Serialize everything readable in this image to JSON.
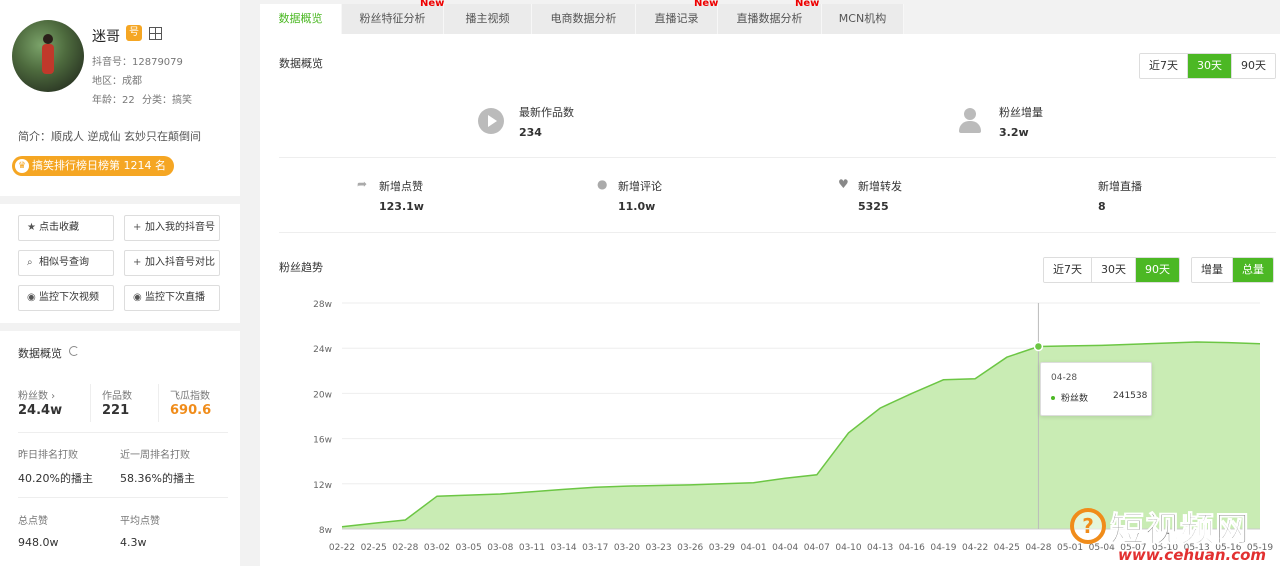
{
  "profile": {
    "name": "迷哥",
    "douyin_id": "抖音号：12879079",
    "region": "地区：成都",
    "age": "年龄：22",
    "category": "分类：搞笑",
    "bio": "简介：顺成人 逆成仙 玄妙只在颠倒间",
    "rank": "搞笑排行榜日榜第 1214 名"
  },
  "actions": [
    {
      "icon": "star-icon",
      "label": "点击收藏"
    },
    {
      "icon": "plus-icon",
      "label": "加入我的抖音号"
    },
    {
      "icon": "search-icon",
      "label": "相似号查询"
    },
    {
      "icon": "plus-icon",
      "label": "加入抖音号对比"
    },
    {
      "icon": "eye-icon",
      "label": "监控下次视频"
    },
    {
      "icon": "eye-icon",
      "label": "监控下次直播"
    }
  ],
  "overview": {
    "title": "数据概览",
    "fans_label": "粉丝数 ›",
    "fans_value": "24.4w",
    "works_label": "作品数",
    "works_value": "221",
    "index_label": "飞瓜指数",
    "index_value": "690.6",
    "yesterday_label": "昨日排名打败",
    "yesterday_value": "40.20%的播主",
    "week_label": "近一周排名打败",
    "week_value": "58.36%的播主",
    "likes_label": "总点赞",
    "likes_value": "948.0w",
    "avg_label": "平均点赞",
    "avg_value": "4.3w"
  },
  "tabs": [
    {
      "label": "数据概览",
      "active": true,
      "new": false
    },
    {
      "label": "粉丝特征分析",
      "active": false,
      "new": true
    },
    {
      "label": "播主视频",
      "active": false,
      "new": false
    },
    {
      "label": "电商数据分析",
      "active": false,
      "new": false
    },
    {
      "label": "直播记录",
      "active": false,
      "new": true
    },
    {
      "label": "直播数据分析",
      "active": false,
      "new": true
    },
    {
      "label": "MCN机构",
      "active": false,
      "new": false
    }
  ],
  "new_label": "New",
  "main": {
    "section_title": "数据概览",
    "range_buttons": [
      "近7天",
      "30天",
      "90天"
    ],
    "range_active": "30天",
    "latest_works_label": "最新作品数",
    "latest_works_value": "234",
    "fans_inc_label": "粉丝增量",
    "fans_inc_value": "3.2w",
    "likes_inc_label": "新增点赞",
    "likes_inc_value": "123.1w",
    "comments_inc_label": "新增评论",
    "comments_inc_value": "11.0w",
    "shares_inc_label": "新增转发",
    "shares_inc_value": "5325",
    "live_inc_label": "新增直播",
    "live_inc_value": "8"
  },
  "trend": {
    "title": "粉丝趋势",
    "range_buttons": [
      "近7天",
      "30天",
      "90天"
    ],
    "range_active": "90天",
    "mode_buttons": [
      "增量",
      "总量"
    ],
    "mode_active": "总量",
    "tooltip_date": "04-28",
    "tooltip_series": "粉丝数",
    "tooltip_value": "241538"
  },
  "watermark": {
    "text": "短视频网",
    "url": "www.cehuan.com",
    "mark": "?"
  },
  "colors": {
    "accent": "#4cb824",
    "orange": "#f08c1a",
    "area": "#c9ecb4",
    "line": "#6cc644"
  },
  "chart_data": {
    "type": "area",
    "ylabels": [
      "8w",
      "12w",
      "16w",
      "20w",
      "24w",
      "28w"
    ],
    "ylim": [
      80000,
      280000
    ],
    "x": [
      "02-22",
      "02-25",
      "02-28",
      "03-02",
      "03-05",
      "03-08",
      "03-11",
      "03-14",
      "03-17",
      "03-20",
      "03-23",
      "03-26",
      "03-29",
      "04-01",
      "04-04",
      "04-07",
      "04-10",
      "04-13",
      "04-16",
      "04-19",
      "04-22",
      "04-25",
      "04-28",
      "05-01",
      "05-04",
      "05-07",
      "05-10",
      "05-13",
      "05-16",
      "05-19"
    ],
    "series": [
      {
        "name": "粉丝数",
        "values": [
          82000,
          85000,
          88000,
          109000,
          110000,
          111000,
          113000,
          115000,
          117000,
          118000,
          118500,
          119000,
          120000,
          121000,
          125000,
          128000,
          165000,
          187000,
          200000,
          212000,
          213000,
          232000,
          241538,
          242000,
          242500,
          243500,
          244500,
          245500,
          245000,
          244000
        ]
      }
    ],
    "highlight_index": 22
  }
}
